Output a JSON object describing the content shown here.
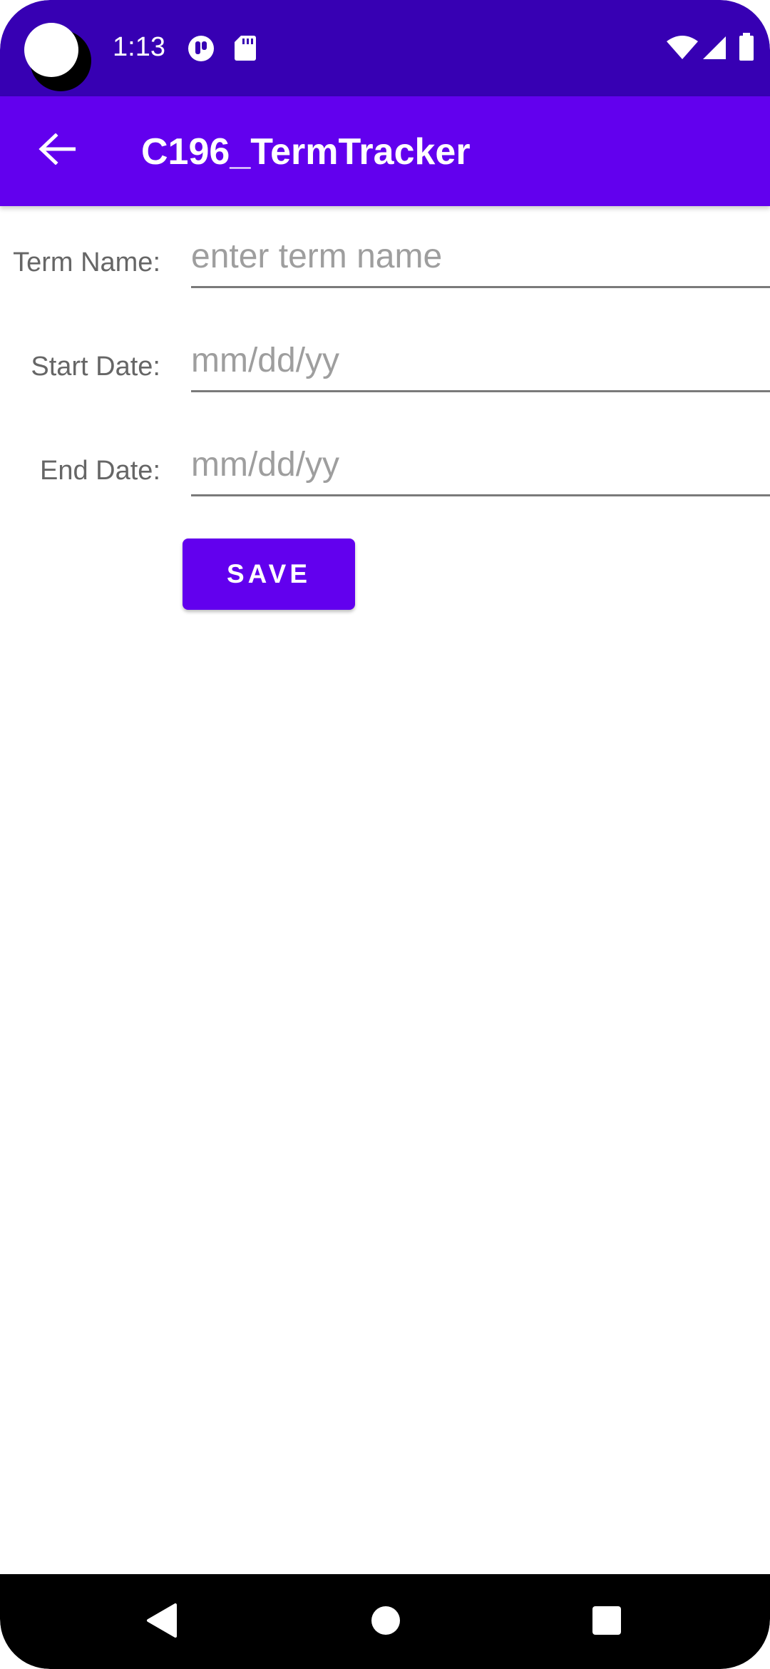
{
  "status_bar": {
    "time": "1:13",
    "icons": [
      "notification-app-icon",
      "sd-card-icon",
      "wifi-icon",
      "cell-signal-icon",
      "battery-icon"
    ],
    "background_color": "#3700b3"
  },
  "app_bar": {
    "title": "C196_TermTracker",
    "back_icon": "arrow-back-icon",
    "background_color": "#6200ee"
  },
  "form": {
    "term_name": {
      "label": "Term Name:",
      "value": "",
      "placeholder": "enter term name"
    },
    "start_date": {
      "label": "Start Date:",
      "value": "",
      "placeholder": "mm/dd/yy"
    },
    "end_date": {
      "label": "End Date:",
      "value": "",
      "placeholder": "mm/dd/yy"
    },
    "save_label": "SAVE"
  },
  "nav_bar": {
    "buttons": [
      "back-triangle-icon",
      "home-circle-icon",
      "recents-square-icon"
    ]
  }
}
